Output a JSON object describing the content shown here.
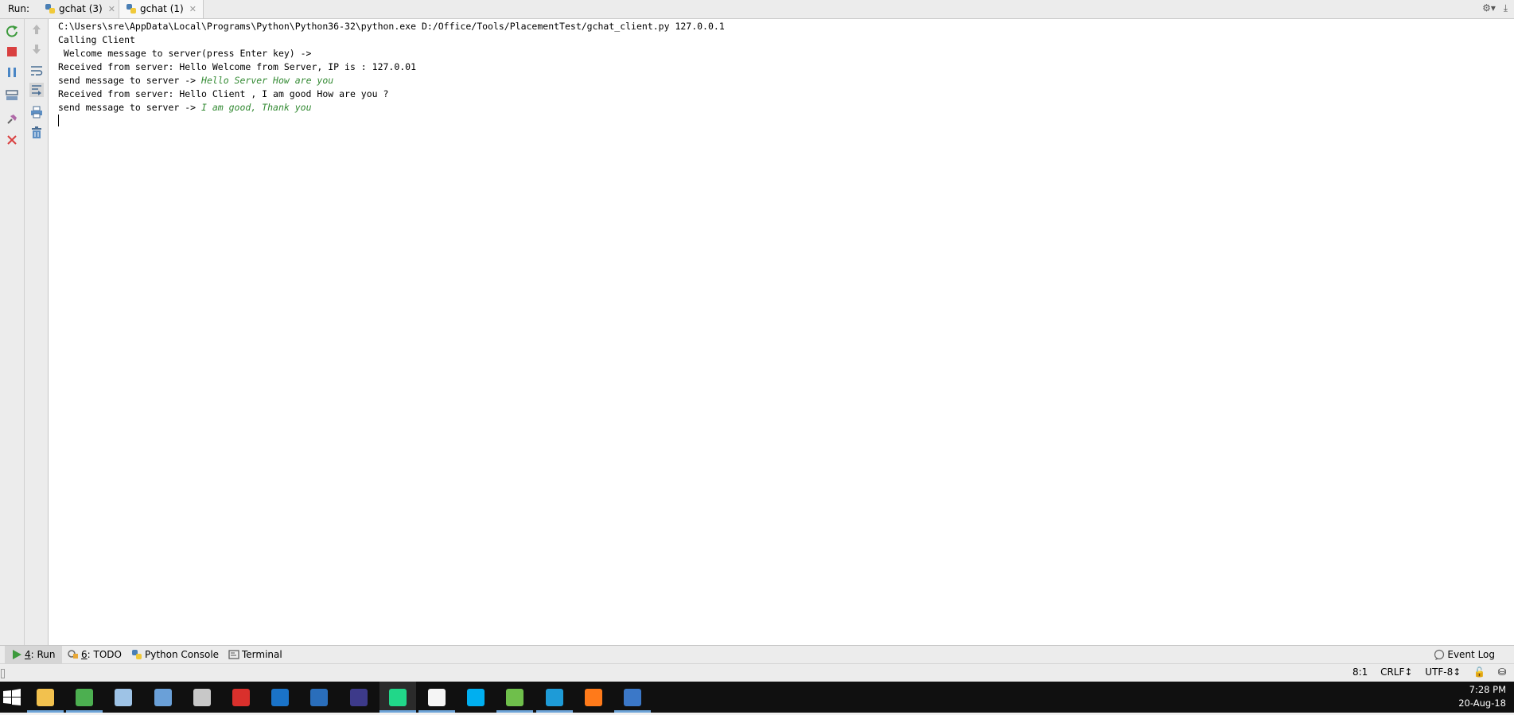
{
  "run_panel": {
    "label": "Run:",
    "tabs": [
      {
        "title": "gchat (3)",
        "active": false
      },
      {
        "title": "gchat (1)",
        "active": true
      }
    ]
  },
  "console": {
    "command": "C:\\Users\\sre\\AppData\\Local\\Programs\\Python\\Python36-32\\python.exe D:/Office/Tools/PlacementTest/gchat_client.py 127.0.0.1",
    "lines": [
      {
        "text": "Calling Client",
        "input": ""
      },
      {
        "text": " Welcome message to server(press Enter key) ->",
        "input": ""
      },
      {
        "text": "Received from server: Hello Welcome from Server, IP is : 127.0.01",
        "input": ""
      },
      {
        "text": "send message to server -> ",
        "input": "Hello Server How are you"
      },
      {
        "text": "Received from server: Hello Client , I am good How are you ?",
        "input": ""
      },
      {
        "text": "send message to server -> ",
        "input": "I am good, Thank you"
      }
    ]
  },
  "tool_windows": {
    "run": {
      "number": "4",
      "label": ": Run"
    },
    "todo": {
      "number": "6",
      "label": ": TODO"
    },
    "python_console": "Python Console",
    "terminal": "Terminal",
    "event_log": "Event Log"
  },
  "status_bar": {
    "position": "8:1",
    "line_separator": "CRLF↕",
    "encoding": "UTF-8↕"
  },
  "taskbar": {
    "time": "7:28 PM",
    "date": "20-Aug-18",
    "apps": [
      {
        "icon": "file-explorer-icon",
        "color": "#f2c14e",
        "running": true,
        "focused": false
      },
      {
        "icon": "chrome-icon",
        "color": "#4caf50",
        "running": true,
        "focused": false
      },
      {
        "icon": "paint-icon",
        "color": "#9ec3e6",
        "running": false,
        "focused": false
      },
      {
        "icon": "remote-desktop-icon",
        "color": "#6aa0d8",
        "running": false,
        "focused": false
      },
      {
        "icon": "key-tool-icon",
        "color": "#c8c8c8",
        "running": false,
        "focused": false
      },
      {
        "icon": "acrobat-icon",
        "color": "#d9302c",
        "running": false,
        "focused": false
      },
      {
        "icon": "outlook-icon",
        "color": "#1a73c8",
        "running": false,
        "focused": false
      },
      {
        "icon": "r-icon",
        "color": "#2a6ebb",
        "running": false,
        "focused": false
      },
      {
        "icon": "eclipse-icon",
        "color": "#3d3a8a",
        "running": false,
        "focused": false
      },
      {
        "icon": "pycharm-icon",
        "color": "#21d789",
        "running": true,
        "focused": true
      },
      {
        "icon": "sticky-notes-icon",
        "color": "#f5f5f5",
        "running": true,
        "focused": false
      },
      {
        "icon": "skype-icon",
        "color": "#00aff0",
        "running": false,
        "focused": false
      },
      {
        "icon": "editor-icon",
        "color": "#6fbf4b",
        "running": true,
        "focused": false
      },
      {
        "icon": "downloader-icon",
        "color": "#1e9bd7",
        "running": true,
        "focused": false
      },
      {
        "icon": "firefox-icon",
        "color": "#ff7a1a",
        "running": false,
        "focused": false
      },
      {
        "icon": "network-icon",
        "color": "#3b78c8",
        "running": true,
        "focused": false
      }
    ]
  },
  "colors": {
    "user_input": "#338a33",
    "rerun": "#3c9a3c",
    "stop": "#d94040",
    "taskbar": "#101010"
  }
}
